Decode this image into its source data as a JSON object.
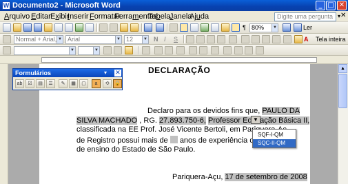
{
  "window": {
    "title": "Documento2 - Microsoft Word",
    "icon": "word-app-icon",
    "controls": {
      "minimize": "_",
      "maximize": "□",
      "close": "✕"
    }
  },
  "menubar": {
    "items": [
      {
        "label": "Arquivo",
        "ul": "A",
        "rest": "rquivo"
      },
      {
        "label": "Editar",
        "ul": "E",
        "rest": "ditar"
      },
      {
        "label": "Exibir",
        "pre": "E",
        "ul": "x",
        "rest": "ibir"
      },
      {
        "label": "Inserir",
        "ul": "I",
        "rest": "nserir"
      },
      {
        "label": "Formatar",
        "ul": "F",
        "rest": "ormatar"
      },
      {
        "label": "Ferramentas",
        "pre": "Ferra",
        "ul": "m",
        "rest": "entas"
      },
      {
        "label": "Tabela",
        "pre": "Ta",
        "ul": "b",
        "rest": "ela"
      },
      {
        "label": "Janela",
        "ul": "J",
        "rest": "anela"
      },
      {
        "label": "Ajuda",
        "pre": "Aj",
        "ul": "u",
        "rest": "da"
      }
    ],
    "help_placeholder": "Digite uma pergunta",
    "doc_close": "✕"
  },
  "toolbar_standard": {
    "zoom": "80%",
    "read_label": "Ler"
  },
  "toolbar_formatting": {
    "style": "Normal + Arial, Justi",
    "font": "Arial",
    "size": "12",
    "full_screen_label": "Tela inteira"
  },
  "forms_toolbar": {
    "title": "Formulários",
    "dropdown_glyph": "▾",
    "close_glyph": "✕"
  },
  "document": {
    "heading": "DECLARAÇÃO",
    "line1_prefix": "Declaro para os devidos fins que,",
    "name_first": "PAULO DA",
    "name_second": "SILVA MACHADO",
    "rg_label": ", RG.",
    "rg_value": "27.893.750-6,",
    "role": "Professor Educação Básica II,",
    "line3": "classificada na EE Prof. José Vicente Bertoli, em Pariquera-Aç",
    "line4_a": "de Registro possui mais de",
    "line4_b": "anos de experiência docente n",
    "line5": "de ensino do Estado de São Paulo.",
    "date_place": "Pariquera-Açu,",
    "date_value": "17 de setembro de 2008"
  },
  "dropdown": {
    "field_glyph": "▼",
    "options": [
      "SQF-I-QM",
      "SQC-II-QM"
    ],
    "selected_index": 1
  }
}
